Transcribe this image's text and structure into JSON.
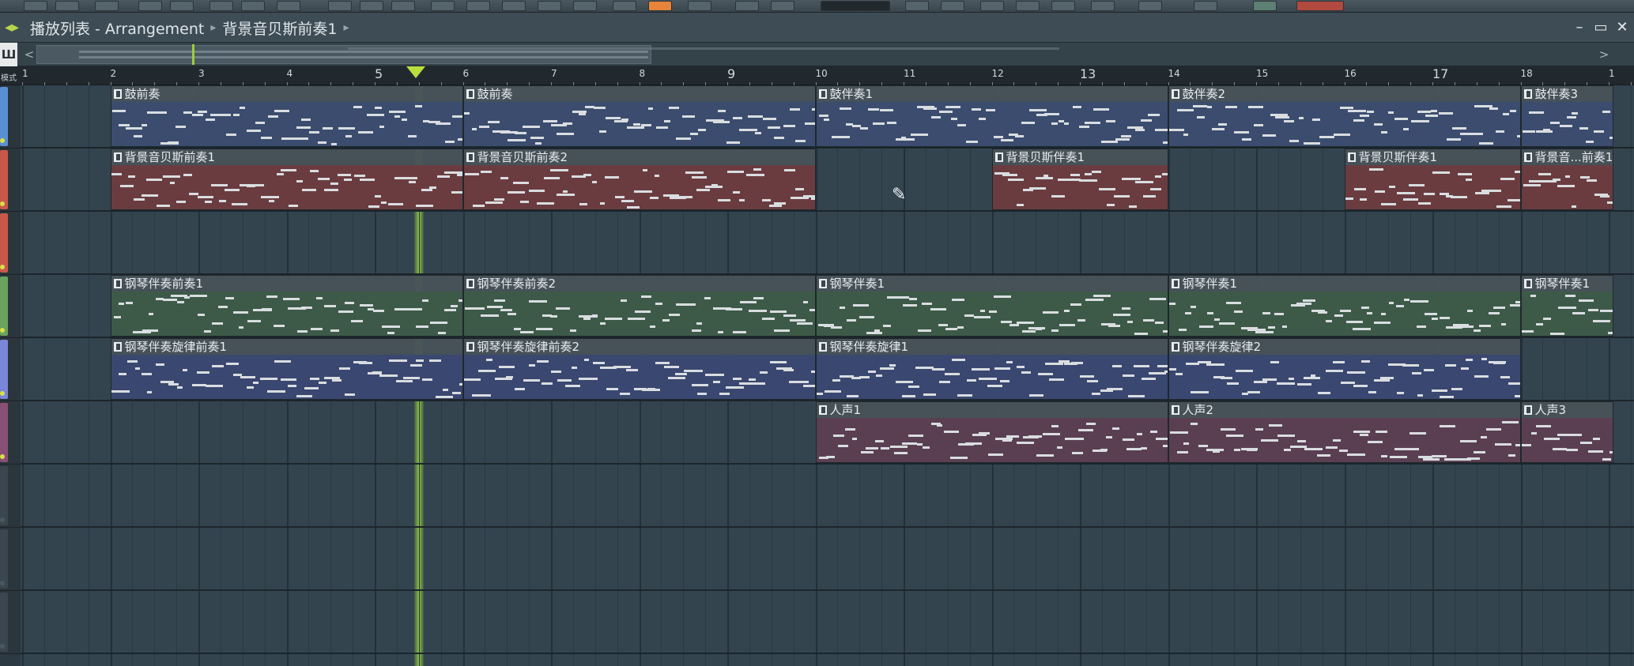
{
  "window": {
    "breadcrumb": [
      "播放列表 - Arrangement",
      "背景音贝斯前奏1"
    ],
    "controls": {
      "minimize": "–",
      "maximize": "▭",
      "close": "✕"
    }
  },
  "overview": {
    "mode_label": "Ш",
    "left_arrow": "<",
    "right_arrow": ">"
  },
  "ruler": {
    "mode_label": "模式",
    "bars": [
      "1",
      "2",
      "3",
      "4",
      "5",
      "6",
      "7",
      "8",
      "9",
      "10",
      "11",
      "12",
      "13",
      "14",
      "15",
      "16",
      "17",
      "18",
      "1"
    ]
  },
  "tracks": [
    {
      "color": "#5b8fd4",
      "clips": [
        {
          "label": "鼓前奏",
          "style": "blue",
          "start": 1.0,
          "len": 4.0
        },
        {
          "label": "鼓前奏",
          "style": "blue",
          "start": 5.0,
          "len": 4.0
        },
        {
          "label": "鼓伴奏1",
          "style": "blue",
          "start": 9.0,
          "len": 4.0
        },
        {
          "label": "鼓伴奏2",
          "style": "blue",
          "start": 13.0,
          "len": 4.0
        },
        {
          "label": "鼓伴奏3",
          "style": "blue",
          "start": 17.0,
          "len": 1.05
        }
      ]
    },
    {
      "color": "#c9584b",
      "clips": [
        {
          "label": "背景音贝斯前奏1",
          "style": "red",
          "start": 1.0,
          "len": 4.0
        },
        {
          "label": "背景音贝斯前奏2",
          "style": "red",
          "start": 5.0,
          "len": 4.0
        },
        {
          "label": "背景贝斯伴奏1",
          "style": "red",
          "start": 11.0,
          "len": 2.0
        },
        {
          "label": "背景贝斯伴奏1",
          "style": "red",
          "start": 15.0,
          "len": 2.0
        },
        {
          "label": "背景音...前奏1",
          "style": "red",
          "start": 17.0,
          "len": 1.05
        }
      ]
    },
    {
      "color": "#c9584b",
      "clips": []
    },
    {
      "color": "#6aa35e",
      "clips": [
        {
          "label": "钢琴伴奏前奏1",
          "style": "green",
          "start": 1.0,
          "len": 4.0
        },
        {
          "label": "钢琴伴奏前奏2",
          "style": "green",
          "start": 5.0,
          "len": 4.0
        },
        {
          "label": "钢琴伴奏1",
          "style": "green",
          "start": 9.0,
          "len": 4.0
        },
        {
          "label": "钢琴伴奏1",
          "style": "green",
          "start": 13.0,
          "len": 4.0
        },
        {
          "label": "钢琴伴奏1",
          "style": "green",
          "start": 17.0,
          "len": 1.05
        }
      ]
    },
    {
      "color": "#7a86d8",
      "clips": [
        {
          "label": "钢琴伴奏旋律前奏1",
          "style": "purple",
          "start": 1.0,
          "len": 4.0
        },
        {
          "label": "钢琴伴奏旋律前奏2",
          "style": "purple",
          "start": 5.0,
          "len": 4.0
        },
        {
          "label": "钢琴伴奏旋律1",
          "style": "purple",
          "start": 9.0,
          "len": 4.0
        },
        {
          "label": "钢琴伴奏旋律2",
          "style": "purple",
          "start": 13.0,
          "len": 4.0
        }
      ]
    },
    {
      "color": "#8a4f76",
      "clips": [
        {
          "label": "人声1",
          "style": "mauve",
          "start": 9.0,
          "len": 4.0
        },
        {
          "label": "人声2",
          "style": "mauve",
          "start": 13.0,
          "len": 4.0
        },
        {
          "label": "人声3",
          "style": "mauve",
          "start": 17.0,
          "len": 1.05
        }
      ]
    },
    {
      "color": "#3a4750",
      "clips": []
    },
    {
      "color": "#3a4750",
      "clips": []
    },
    {
      "color": "#3a4750",
      "clips": []
    }
  ]
}
